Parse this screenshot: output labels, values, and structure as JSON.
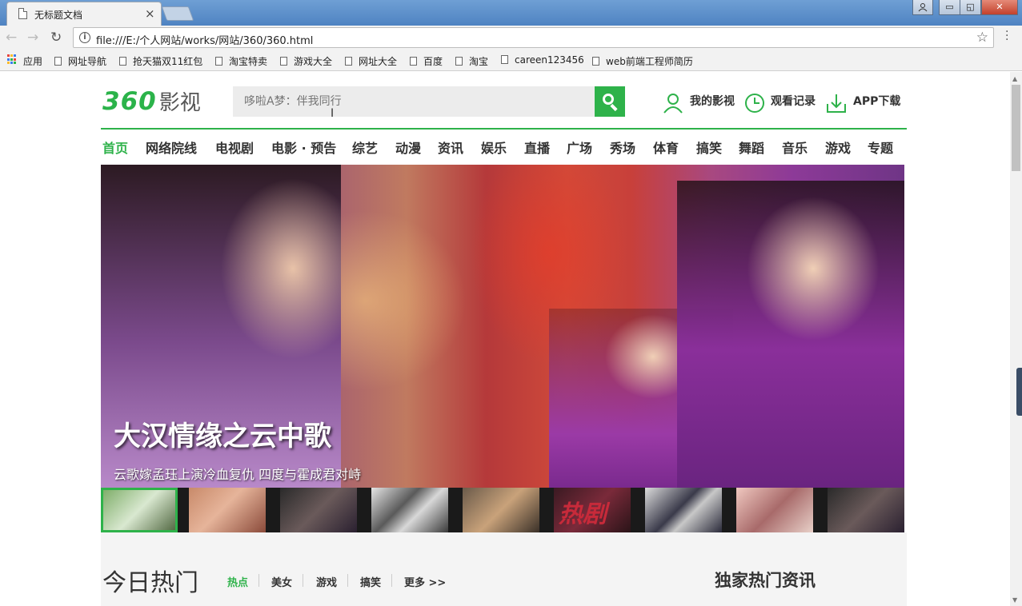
{
  "browser": {
    "tab_title": "无标题文档",
    "tab_close": "×",
    "url": "file:///E:/个人网站/works/网站/360/360.html",
    "window_buttons": {
      "minimize": "▭",
      "restore": "◱",
      "close": "✕"
    }
  },
  "bookmarks": [
    "应用",
    "网址导航",
    "抢天猫双11红包",
    "淘宝特卖",
    "游戏大全",
    "网址大全",
    "百度",
    "淘宝",
    "careen123456",
    "web前端工程师简历"
  ],
  "header": {
    "logo_num": "360",
    "logo_cn": "影视",
    "search_placeholder": "哆啦A梦：伴我同行",
    "links": {
      "my_videos": "我的影视",
      "history": "观看记录",
      "app": "APP下载"
    }
  },
  "nav": [
    "首页",
    "网络院线",
    "电视剧",
    "电影 · 预告",
    "综艺",
    "动漫",
    "资讯",
    "娱乐",
    "直播",
    "广场",
    "秀场",
    "体育",
    "搞笑",
    "舞蹈",
    "音乐",
    "游戏",
    "专题"
  ],
  "banner": {
    "title": "大汉情缘之云中歌",
    "subtitle": "云歌嫁孟珏上演冷血复仇 四度与霍成君对峙"
  },
  "thumbnail_text": "热剧",
  "hot": {
    "title": "今日热门",
    "tabs": [
      "热点",
      "美女",
      "游戏",
      "搞笑",
      "更多 >>"
    ],
    "news_title": "独家热门资讯"
  },
  "colors": {
    "brand_green": "#2eb24a"
  }
}
